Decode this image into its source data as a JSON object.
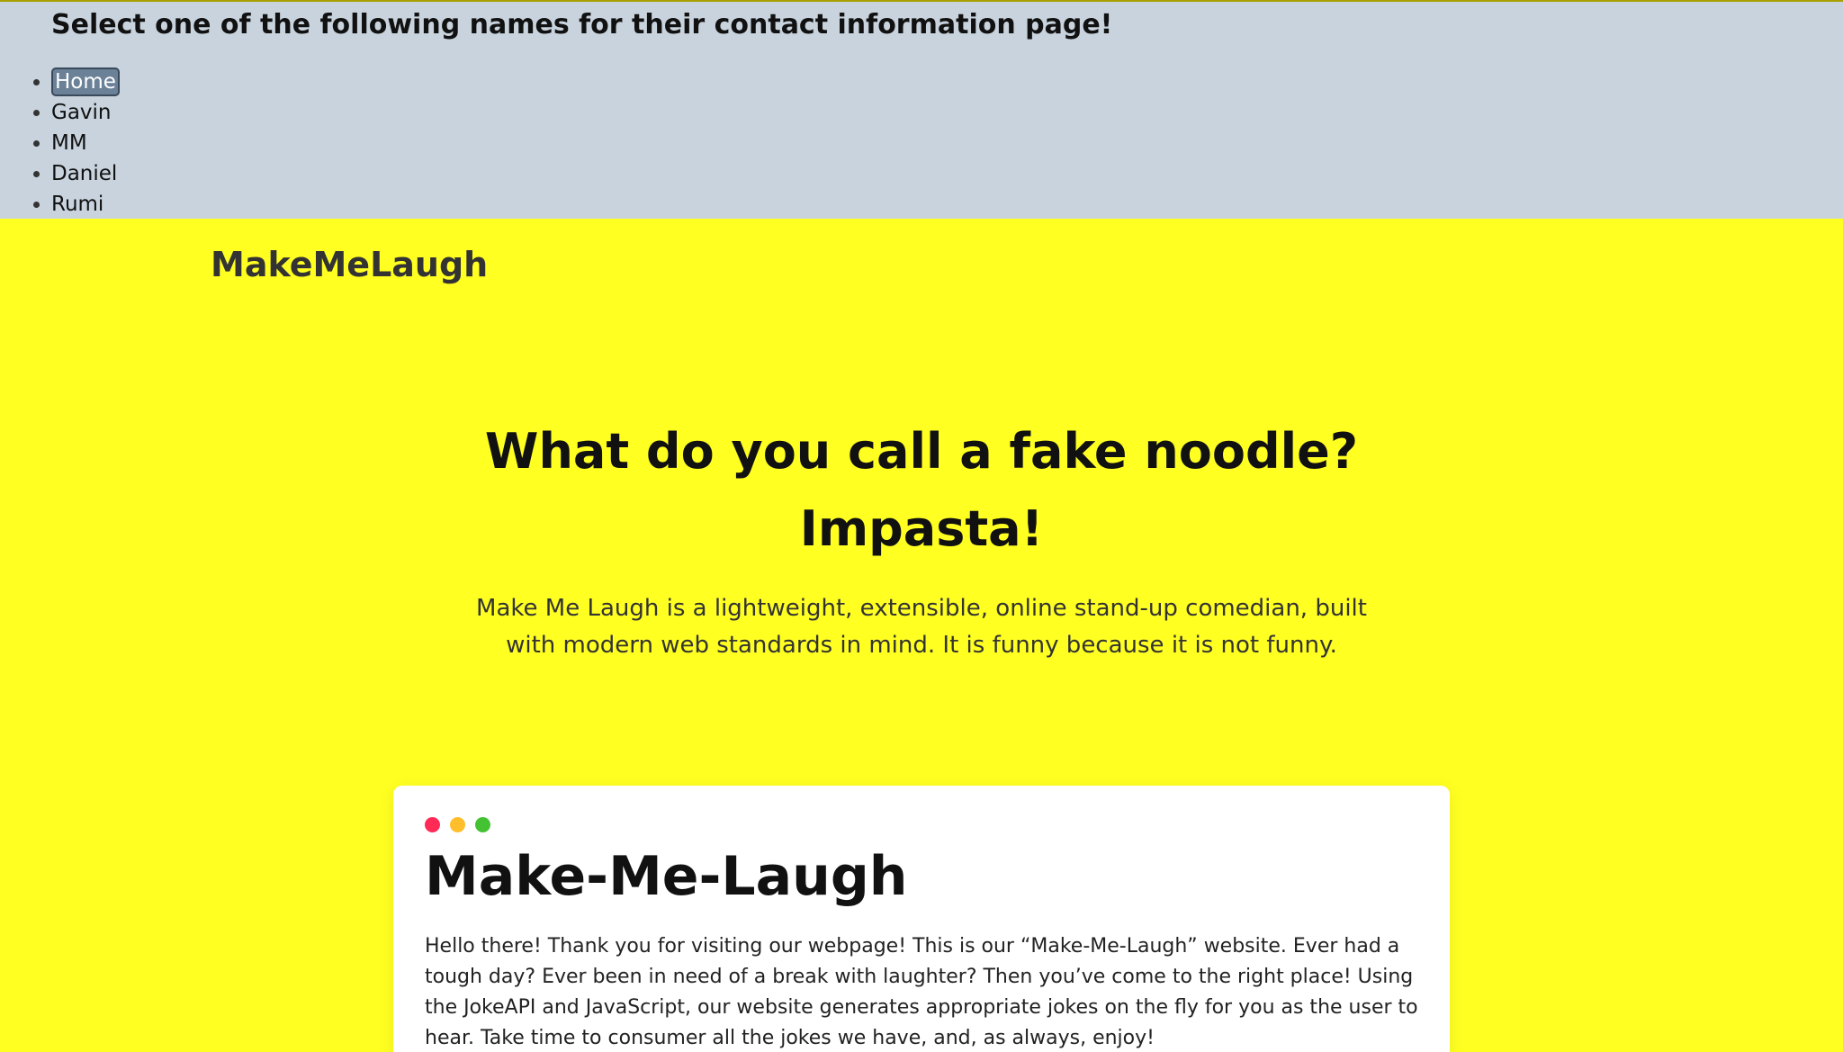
{
  "nav": {
    "heading": "Select one of the following names for their contact information page!",
    "items": [
      {
        "label": "Home",
        "active": true
      },
      {
        "label": "Gavin"
      },
      {
        "label": "MM"
      },
      {
        "label": "Daniel"
      },
      {
        "label": "Rumi"
      }
    ]
  },
  "brand": "MakeMeLaugh",
  "hero": {
    "question": "What do you call a fake noodle?",
    "answer": "Impasta!",
    "description": "Make Me Laugh is a lightweight, extensible, online stand-up comedian, built with modern web standards in mind. It is funny because it is not funny."
  },
  "card": {
    "title": "Make-Me-Laugh",
    "body": "Hello there! Thank you for visiting our webpage! This is our “Make-Me-Laugh” website. Ever had a tough day? Ever been in need of a break with laughter? Then you’ve come to the right place! Using the JokeAPI and JavaScript, our website generates appropriate jokes on the fly for you as the user to hear. Take time to consumer all the jokes we have, and, as always, enjoy!"
  },
  "colors": {
    "page_background": "#ffff22",
    "nav_background": "#c8d3dd",
    "dot_red": "#ff2a55",
    "dot_yellow": "#ffbf2d",
    "dot_green": "#44c234"
  }
}
